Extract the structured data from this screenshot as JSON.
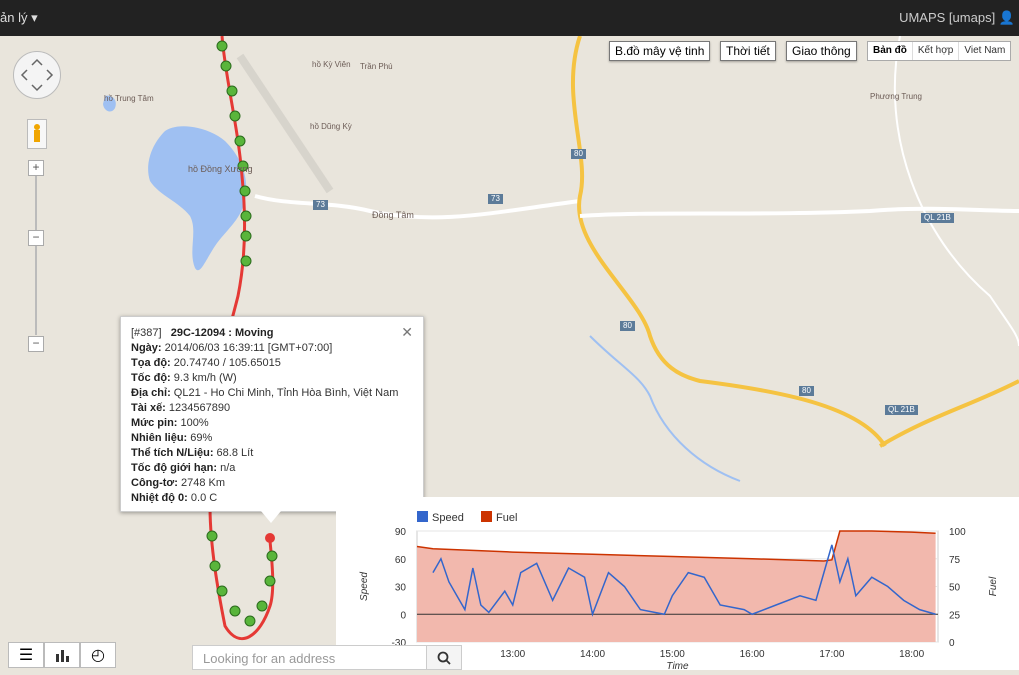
{
  "topbar": {
    "menu_label": "ản lý",
    "user_label": "UMAPS [umaps]"
  },
  "maptypes": {
    "satellite": "B.đồ mây vệ tinh",
    "weather": "Thời tiết",
    "traffic": "Giao thông",
    "map": "Bản đồ",
    "hybrid": "Kết hợp",
    "vietnam": "Viet Nam"
  },
  "map_labels": {
    "ho_trung": "hồ Trung Tâm",
    "ho_ky_vien": "hồ Kỳ Viên",
    "tran_phu": "Trần Phú",
    "ho_dung_ky": "hồ Dũng Kỳ",
    "ho_dong_xuong": "hồ Đồng Xương",
    "dong_tam": "Đồng Tâm",
    "phuong_trung": "Phương Trung",
    "r73a": "73",
    "r73b": "73",
    "r80a": "80",
    "r80b": "80",
    "r80c": "80",
    "ql21b_a": "QL 21B",
    "ql21b_b": "QL 21B"
  },
  "popup": {
    "id": "[#387]",
    "title": "29C-12094 : Moving",
    "rows": [
      {
        "k": "Ngày:",
        "v": "2014/06/03 16:39:11 [GMT+07:00]"
      },
      {
        "k": "Tọa độ:",
        "v": "20.74740 / 105.65015"
      },
      {
        "k": "Tốc độ:",
        "v": "9.3 km/h  (W)"
      },
      {
        "k": "Địa chỉ:",
        "v": "QL21 - Ho Chi Minh, Tỉnh Hòa Bình, Việt Nam"
      },
      {
        "k": "Tài xế:",
        "v": "1234567890"
      },
      {
        "k": "Mức pin:",
        "v": "100%"
      },
      {
        "k": "Nhiên liệu:",
        "v": "69%"
      },
      {
        "k": "Thể tích N/Liệu:",
        "v": "68.8 Lít"
      },
      {
        "k": "Tốc độ giới hạn:",
        "v": "n/a"
      },
      {
        "k": "Công-tơ:",
        "v": "2748 Km"
      },
      {
        "k": "Nhiệt độ 0:",
        "v": "0.0 C"
      }
    ]
  },
  "search": {
    "placeholder": "Looking for an address"
  },
  "chart_data": {
    "type": "line",
    "xlabel": "Time",
    "ylabel_left": "Speed",
    "ylabel_right": "Fuel",
    "x_ticks": [
      "13:00",
      "14:00",
      "15:00",
      "16:00",
      "17:00",
      "18:00"
    ],
    "ylim_left": [
      -30,
      90
    ],
    "yticks_left": [
      90,
      60,
      30,
      0,
      -30
    ],
    "ylim_right": [
      0,
      100
    ],
    "yticks_right": [
      100,
      75,
      50,
      25,
      0
    ],
    "legend": "top-left",
    "series": [
      {
        "name": "Speed",
        "axis": "left",
        "color": "#3366cc",
        "x": [
          12.0,
          12.1,
          12.2,
          12.3,
          12.4,
          12.5,
          12.6,
          12.7,
          12.9,
          13.0,
          13.1,
          13.3,
          13.5,
          13.7,
          13.9,
          14.0,
          14.2,
          14.4,
          14.6,
          14.9,
          15.0,
          15.2,
          15.4,
          15.6,
          15.9,
          16.0,
          16.3,
          16.6,
          16.8,
          16.9,
          17.0,
          17.1,
          17.2,
          17.3,
          17.5,
          17.7,
          17.9,
          18.1,
          18.3
        ],
        "y": [
          45,
          60,
          35,
          20,
          5,
          50,
          10,
          2,
          25,
          10,
          45,
          55,
          15,
          50,
          40,
          0,
          45,
          30,
          5,
          0,
          20,
          45,
          40,
          10,
          5,
          0,
          10,
          20,
          15,
          45,
          75,
          35,
          60,
          20,
          40,
          30,
          15,
          5,
          0
        ]
      },
      {
        "name": "Fuel",
        "axis": "right",
        "color": "#cc3300",
        "x": [
          11.8,
          12.0,
          13.0,
          14.0,
          15.0,
          16.0,
          16.9,
          17.0,
          17.1,
          17.5,
          18.0,
          18.3
        ],
        "y": [
          86,
          84,
          81,
          79,
          77,
          75,
          73,
          74,
          100,
          100,
          99,
          98
        ]
      }
    ]
  }
}
